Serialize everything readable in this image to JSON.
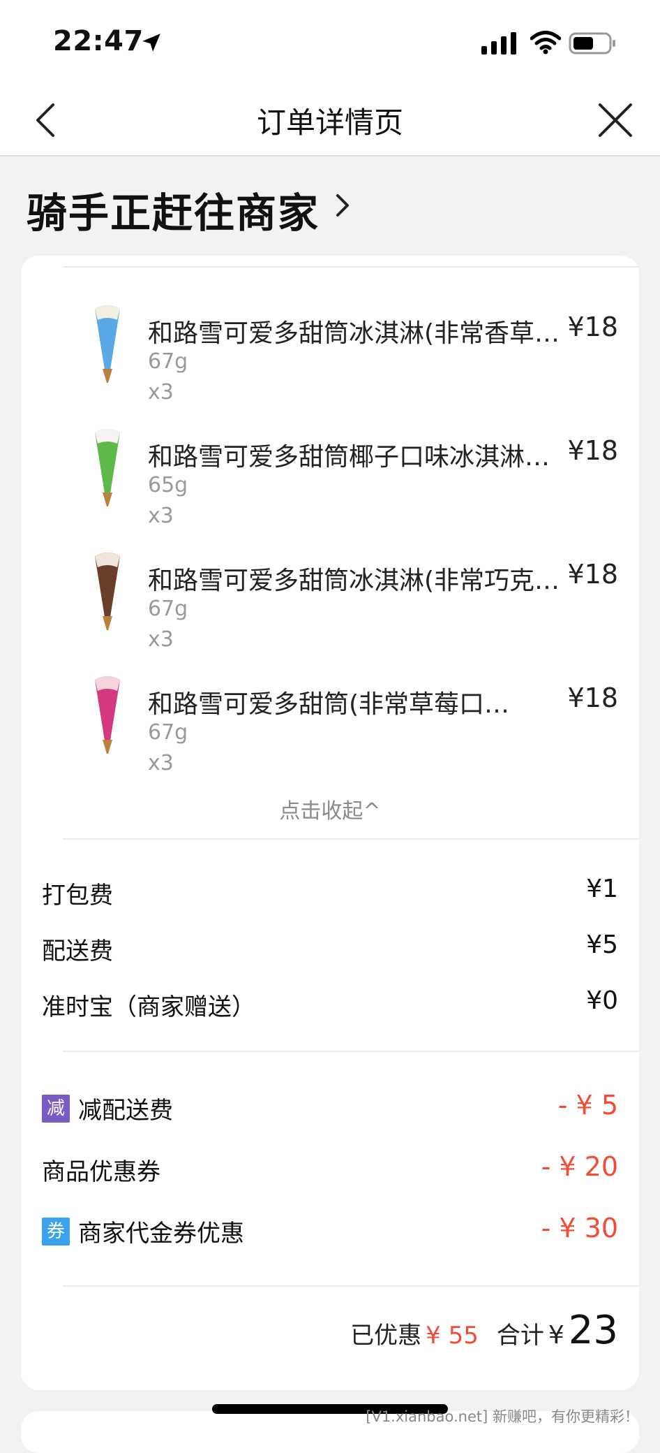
{
  "status_bar": {
    "time": "22:47"
  },
  "nav": {
    "title": "订单详情页"
  },
  "order_status": "骑手正赶往商家",
  "items": [
    {
      "name": "和路雪可爱多甜筒冰淇淋(非常香草…",
      "spec": "67g",
      "qty": "x3",
      "price": "¥18",
      "color": "#5aa9e6"
    },
    {
      "name": "和路雪可爱多甜筒椰子口味冰淇淋…",
      "spec": "65g",
      "qty": "x3",
      "price": "¥18",
      "color": "#5fb84a"
    },
    {
      "name": "和路雪可爱多甜筒冰淇淋(非常巧克…",
      "spec": "67g",
      "qty": "x3",
      "price": "¥18",
      "color": "#6b3e2a"
    },
    {
      "name": "和路雪可爱多甜筒(非常草莓口…",
      "spec": "67g",
      "qty": "x3",
      "price": "¥18",
      "color": "#d6387f"
    }
  ],
  "collapse_label": "点击收起^",
  "fees": [
    {
      "label": "打包费",
      "value": "¥1"
    },
    {
      "label": "配送费",
      "value": "¥5"
    },
    {
      "label": "准时宝（商家赠送）",
      "value": "¥0"
    }
  ],
  "discounts": [
    {
      "tag": "减",
      "tag_color": "#7a5bc4",
      "label": "减配送费",
      "value": "- ¥ 5"
    },
    {
      "tag": "",
      "tag_color": "",
      "label": "商品优惠券",
      "value": "- ¥ 20"
    },
    {
      "tag": "券",
      "tag_color": "#3ba2ee",
      "label": "商家代金券优惠",
      "value": "- ¥ 30"
    }
  ],
  "summary": {
    "saved_label": "已优惠",
    "saved_value": "¥ 55",
    "total_label": "合计",
    "currency": "¥",
    "total_value": "23"
  },
  "watermark": "[V1.xianbao.net] 新赚吧，有你更精彩！"
}
